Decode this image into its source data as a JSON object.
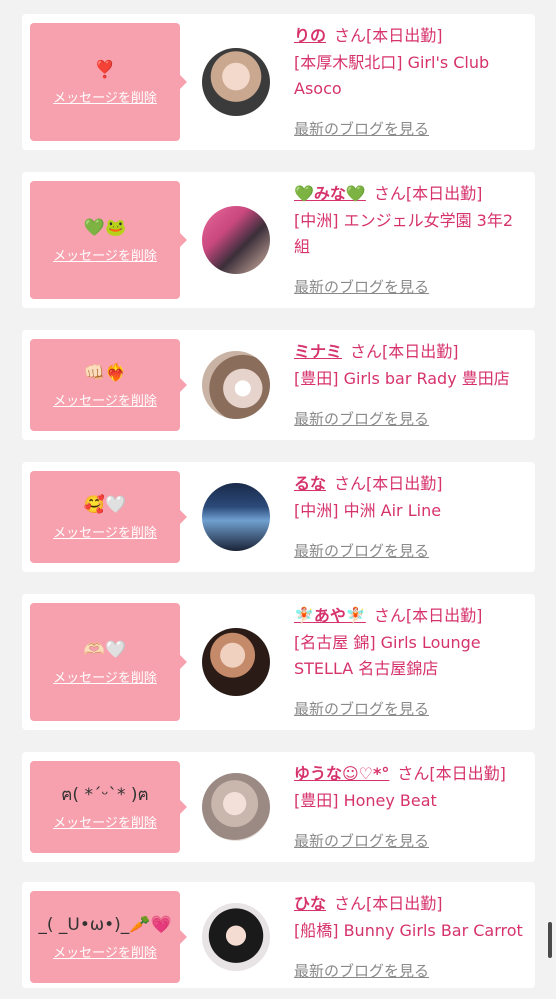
{
  "common": {
    "san": "さん",
    "status": "[本日出勤]",
    "delete_label": "メッセージを削除",
    "blog_label": "最新のブログを見る"
  },
  "cards": [
    {
      "message": "❣️",
      "name": "りの",
      "shop": "[本厚木駅北口] Girl's Club Asoco"
    },
    {
      "message": "💚🐸",
      "name": "💚みな💚",
      "shop": "[中洲] エンジェル女学園 3年2組"
    },
    {
      "message": "👊🏻❤️‍🔥",
      "name": "ミナミ",
      "shop": "[豊田] Girls bar Rady 豊田店"
    },
    {
      "message": "🥰🤍",
      "name": "るな",
      "shop": "[中洲] 中洲 Air Line"
    },
    {
      "message": "🫶🏻🤍",
      "name": "🧚🏻あや🧚🏻",
      "shop": "[名古屋 錦] Girls Lounge STELLA 名古屋錦店"
    },
    {
      "message": "ฅ( *ˊᵕˋ* )ฅ",
      "name": "ゆうな☺︎♡*°",
      "shop": "[豊田] Honey Beat"
    },
    {
      "message": "_( _U•ω•)_🥕💗",
      "name": "ひな",
      "shop": "[船橋] Bunny Girls Bar Carrot"
    }
  ],
  "colors": {
    "bubble": "#f8a1ae",
    "name_text": "#d6336c",
    "blog_text": "#8a8a8a",
    "background": "#f2f2f2"
  }
}
